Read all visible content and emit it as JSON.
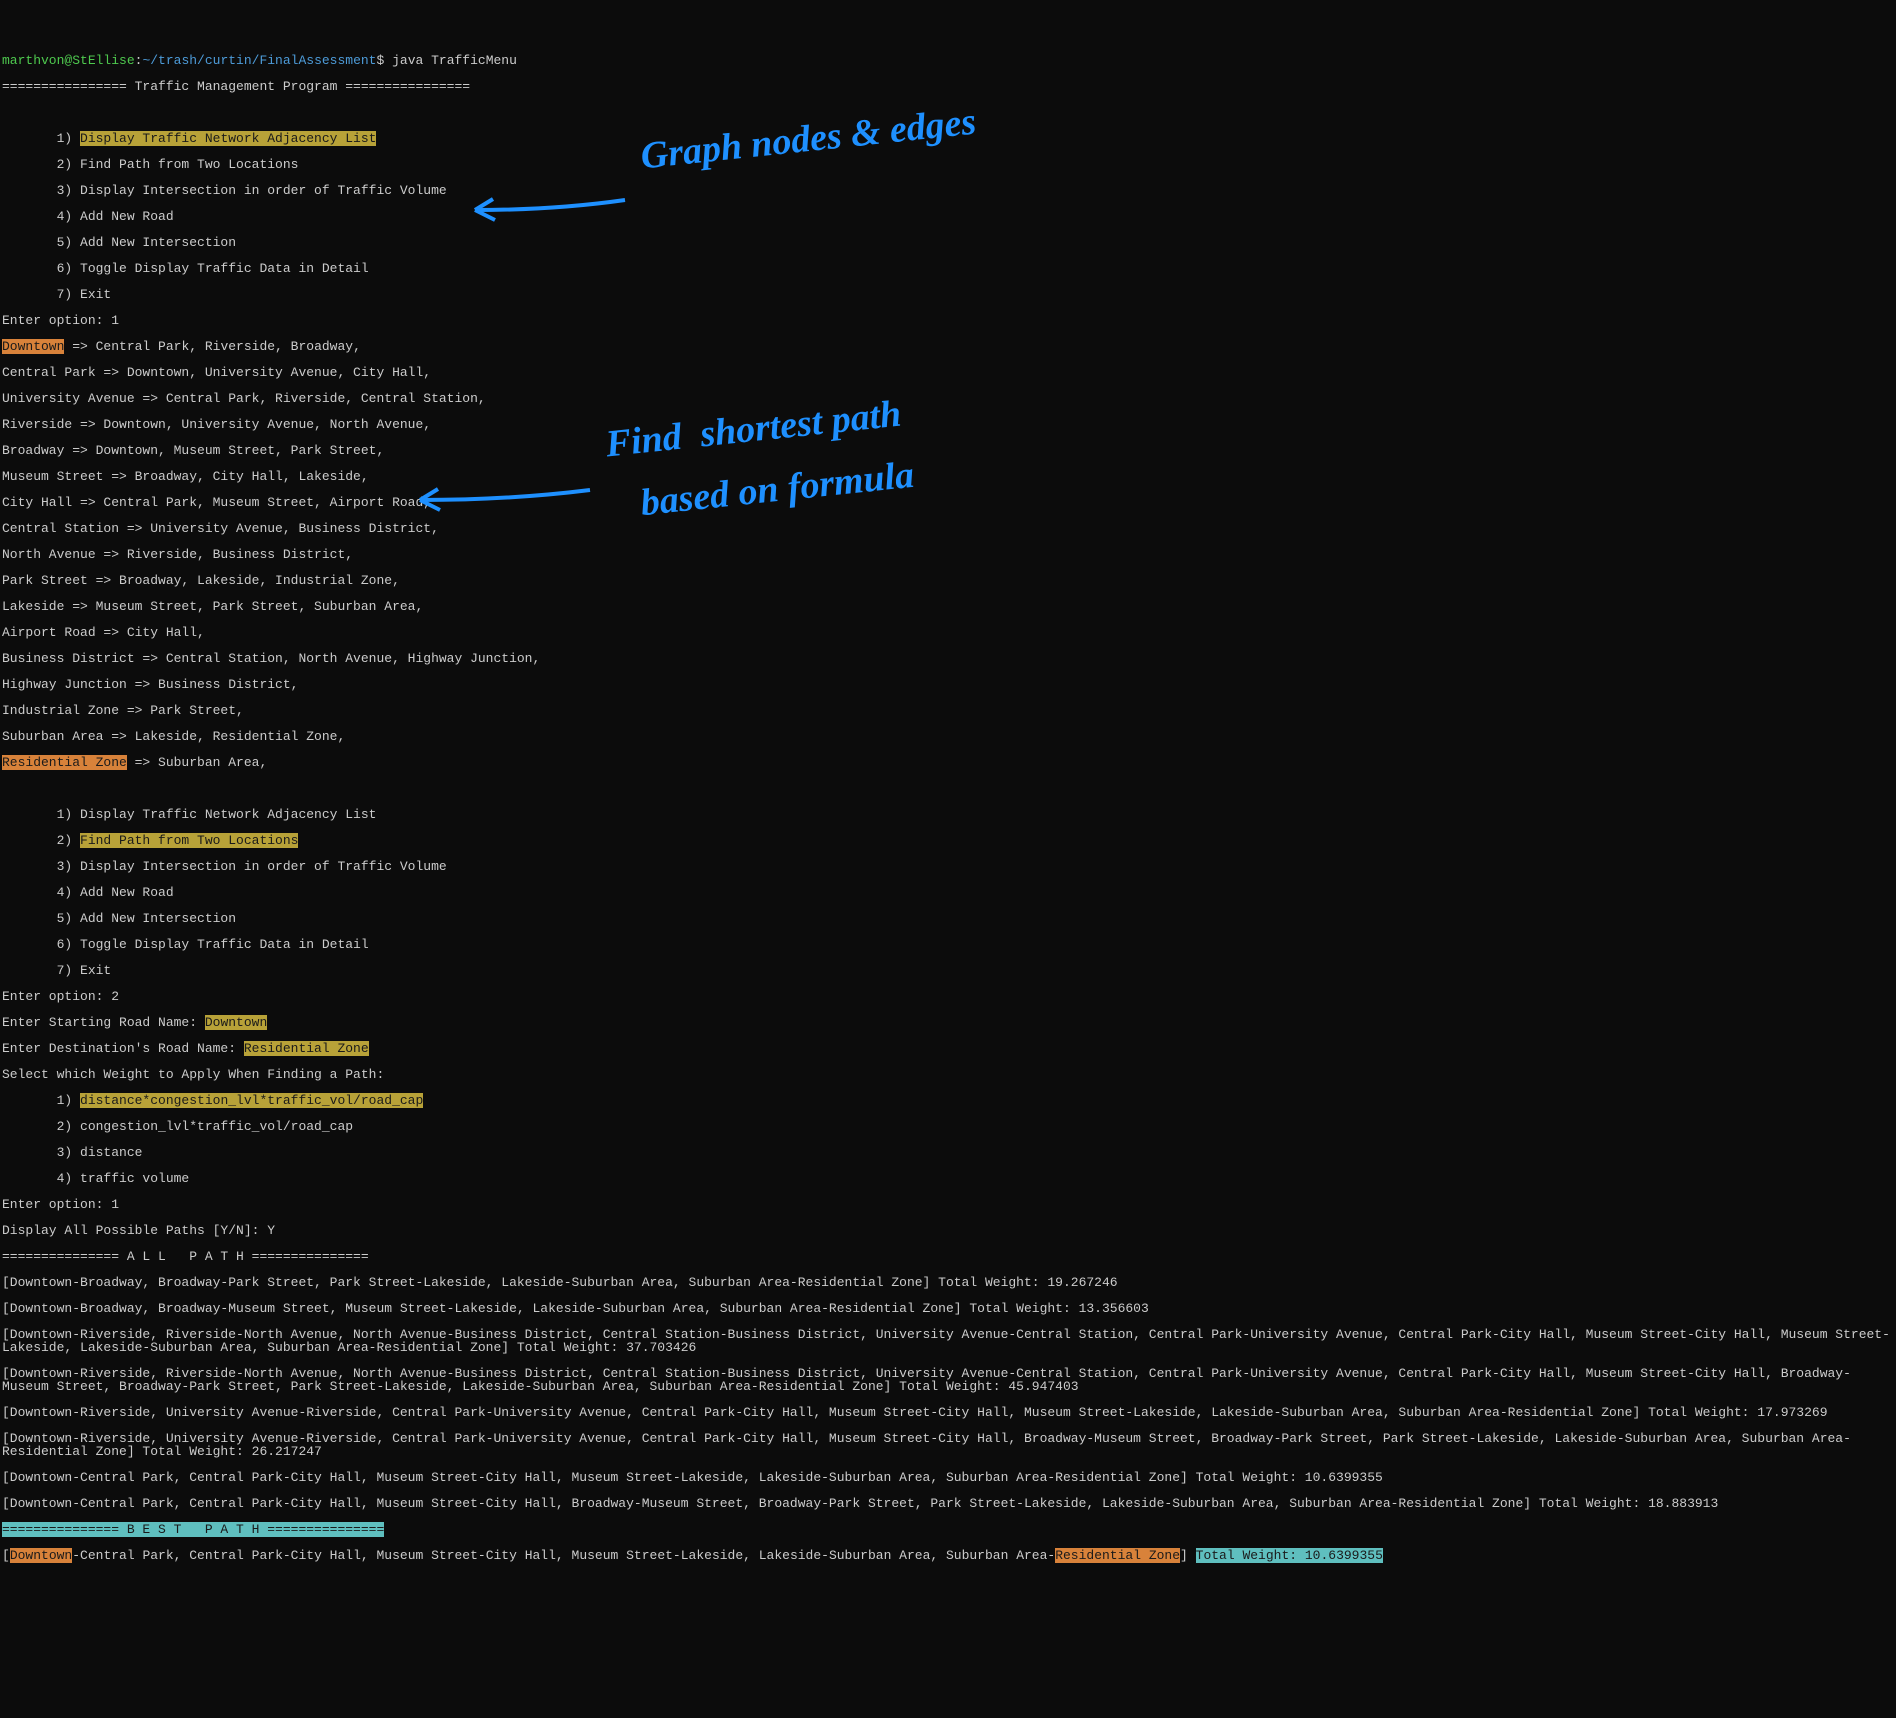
{
  "prompt": {
    "user_host": "marthvon@StEllise",
    "sep1": ":",
    "path": "~/trash/curtin/FinalAssessment",
    "sep2": "$ ",
    "command": "java TrafficMenu"
  },
  "header_line": "================ Traffic Management Program ================",
  "menu1": {
    "opt1_num": "       1) ",
    "opt1_label": "Display Traffic Network Adjacency List",
    "opt2": "       2) Find Path from Two Locations",
    "opt3": "       3) Display Intersection in order of Traffic Volume",
    "opt4": "       4) Add New Road",
    "opt5": "       5) Add New Intersection",
    "opt6": "       6) Toggle Display Traffic Data in Detail",
    "opt7": "       7) Exit",
    "enter": "Enter option: 1"
  },
  "adj": {
    "downtown_label": "Downtown",
    "downtown_rest": " => Central Park, Riverside, Broadway,",
    "l2": "Central Park => Downtown, University Avenue, City Hall,",
    "l3": "University Avenue => Central Park, Riverside, Central Station,",
    "l4": "Riverside => Downtown, University Avenue, North Avenue,",
    "l5": "Broadway => Downtown, Museum Street, Park Street,",
    "l6": "Museum Street => Broadway, City Hall, Lakeside,",
    "l7": "City Hall => Central Park, Museum Street, Airport Road,",
    "l8": "Central Station => University Avenue, Business District,",
    "l9": "North Avenue => Riverside, Business District,",
    "l10": "Park Street => Broadway, Lakeside, Industrial Zone,",
    "l11": "Lakeside => Museum Street, Park Street, Suburban Area,",
    "l12": "Airport Road => City Hall,",
    "l13": "Business District => Central Station, North Avenue, Highway Junction,",
    "l14": "Highway Junction => Business District,",
    "l15": "Industrial Zone => Park Street,",
    "l16": "Suburban Area => Lakeside, Residential Zone,",
    "res_label": "Residential Zone",
    "res_rest": " => Suburban Area,"
  },
  "menu2": {
    "opt1": "       1) Display Traffic Network Adjacency List",
    "opt2_num": "       2) ",
    "opt2_label": "Find Path from Two Locations",
    "opt3": "       3) Display Intersection in order of Traffic Volume",
    "opt4": "       4) Add New Road",
    "opt5": "       5) Add New Intersection",
    "opt6": "       6) Toggle Display Traffic Data in Detail",
    "opt7": "       7) Exit",
    "enter": "Enter option: 2"
  },
  "path_inputs": {
    "start_prompt": "Enter Starting Road Name: ",
    "start_val": "Downtown",
    "dest_prompt": "Enter Destination's Road Name: ",
    "dest_val": "Residential Zone",
    "weight_prompt": "Select which Weight to Apply When Finding a Path:",
    "w1_num": "       1) ",
    "w1_label": "distance*congestion_lvl*traffic_vol/road_cap",
    "w2": "       2) congestion_lvl*traffic_vol/road_cap",
    "w3": "       3) distance",
    "w4": "       4) traffic volume",
    "enter": "Enter option: 1",
    "display": "Display All Possible Paths [Y/N]: Y"
  },
  "allpath_header": "=============== A L L   P A T H ===============",
  "paths": {
    "p1": "[Downtown-Broadway, Broadway-Park Street, Park Street-Lakeside, Lakeside-Suburban Area, Suburban Area-Residential Zone] Total Weight: 19.267246",
    "p2": "[Downtown-Broadway, Broadway-Museum Street, Museum Street-Lakeside, Lakeside-Suburban Area, Suburban Area-Residential Zone] Total Weight: 13.356603",
    "p3": "[Downtown-Riverside, Riverside-North Avenue, North Avenue-Business District, Central Station-Business District, University Avenue-Central Station, Central Park-University Avenue, Central Park-City Hall, Museum Street-City Hall, Museum Street-Lakeside, Lakeside-Suburban Area, Suburban Area-Residential Zone] Total Weight: 37.703426",
    "p4": "[Downtown-Riverside, Riverside-North Avenue, North Avenue-Business District, Central Station-Business District, University Avenue-Central Station, Central Park-University Avenue, Central Park-City Hall, Museum Street-City Hall, Broadway-Museum Street, Broadway-Park Street, Park Street-Lakeside, Lakeside-Suburban Area, Suburban Area-Residential Zone] Total Weight: 45.947403",
    "p5": "[Downtown-Riverside, University Avenue-Riverside, Central Park-University Avenue, Central Park-City Hall, Museum Street-City Hall, Museum Street-Lakeside, Lakeside-Suburban Area, Suburban Area-Residential Zone] Total Weight: 17.973269",
    "p6": "[Downtown-Riverside, University Avenue-Riverside, Central Park-University Avenue, Central Park-City Hall, Museum Street-City Hall, Broadway-Museum Street, Broadway-Park Street, Park Street-Lakeside, Lakeside-Suburban Area, Suburban Area-Residential Zone] Total Weight: 26.217247",
    "p7": "[Downtown-Central Park, Central Park-City Hall, Museum Street-City Hall, Museum Street-Lakeside, Lakeside-Suburban Area, Suburban Area-Residential Zone] Total Weight: 10.6399355",
    "p8": "[Downtown-Central Park, Central Park-City Hall, Museum Street-City Hall, Broadway-Museum Street, Broadway-Park Street, Park Street-Lakeside, Lakeside-Suburban Area, Suburban Area-Residential Zone] Total Weight: 18.883913"
  },
  "bestpath_header": "=============== B E S T   P A T H ===============",
  "best": {
    "b1": "[",
    "b1_hl": "Downtown",
    "b2": "-Central Park, Central Park-City Hall, Museum Street-City Hall, Museum Street-Lakeside, Lakeside-Suburban Area, Suburban Area-",
    "b2_hl": "Residential Zone",
    "b3": "] ",
    "b3_hl": "Total Weight: 10.6399355"
  },
  "annotations": {
    "graph": "Graph nodes & edges",
    "shortest1": "Find  shortest path",
    "shortest2": "based on formula"
  }
}
